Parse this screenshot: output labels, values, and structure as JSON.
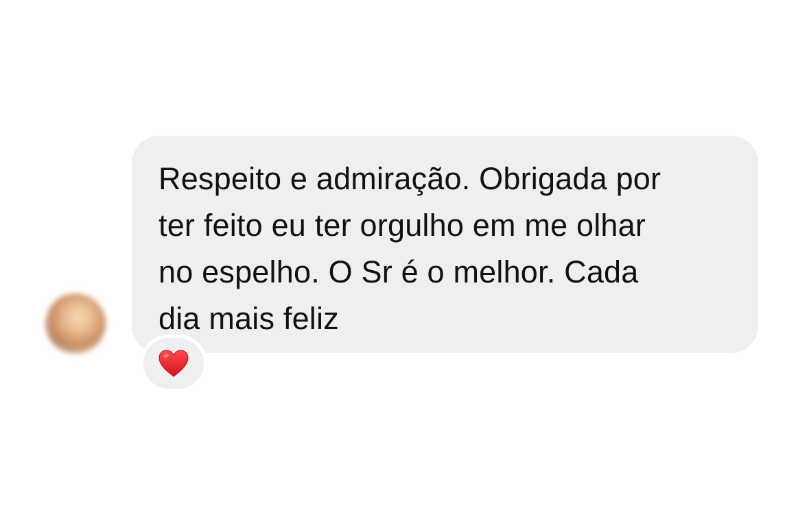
{
  "message": {
    "text": "Respeito e admiração. Obrigada por\nter feito eu ter orgulho em me olhar\nno espelho. O Sr é o melhor. Cada\ndia mais feliz"
  },
  "reaction": {
    "icon": "heart-icon",
    "color": "#e0212b"
  },
  "colors": {
    "bubble": "#efefef",
    "text": "#111111",
    "background": "#ffffff"
  }
}
